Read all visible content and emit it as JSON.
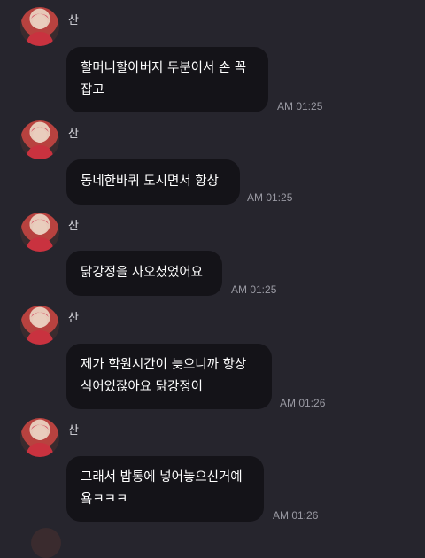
{
  "sender": {
    "name": "산"
  },
  "messages": [
    {
      "lines": [
        "할머니할아버지 두분이서 손 꼭",
        "잡고"
      ],
      "time": "AM 01:25"
    },
    {
      "lines": [
        "동네한바퀴 도시면서 항상"
      ],
      "time": "AM 01:25"
    },
    {
      "lines": [
        "닭강정을 사오셨었어요"
      ],
      "time": "AM 01:25"
    },
    {
      "lines": [
        "제가 학원시간이 늦으니까 항상",
        "식어있잖아요 닭강정이"
      ],
      "time": "AM 01:26"
    },
    {
      "lines": [
        "그래서 밥통에 넣어놓으신거예",
        "욬ㅋㅋㅋ"
      ],
      "time": "AM 01:26"
    }
  ],
  "colors": {
    "background": "#26252d",
    "bubble": "#141318",
    "text": "#ffffff",
    "time": "#9a9aa3"
  }
}
